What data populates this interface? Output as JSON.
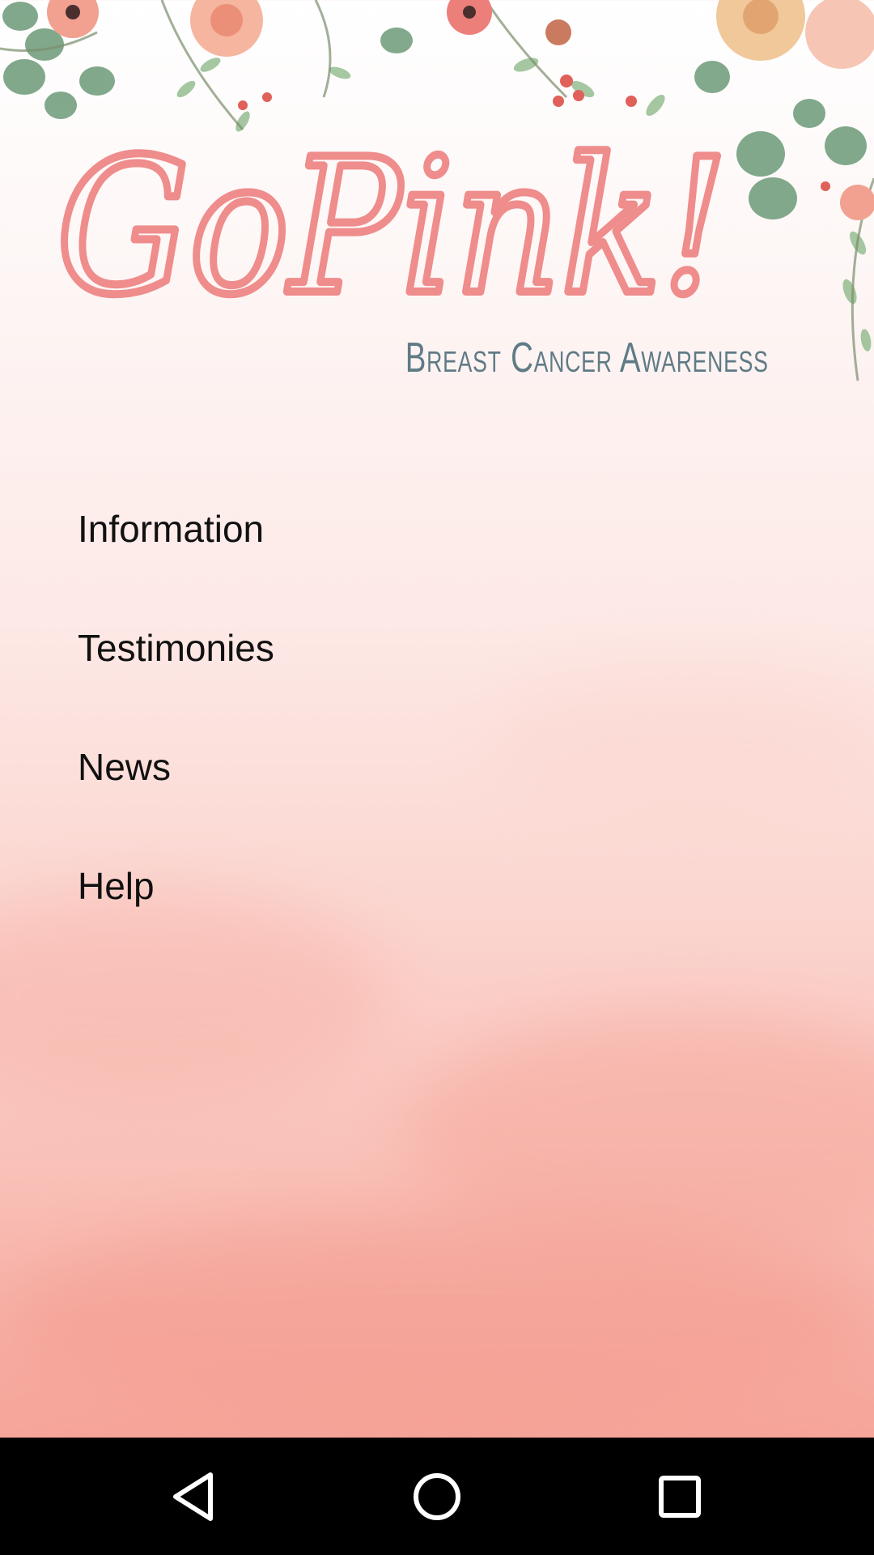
{
  "logo": {
    "title": "GoPink!",
    "subtitle": "Breast Cancer Awareness"
  },
  "menu": {
    "items": [
      {
        "label": "Information"
      },
      {
        "label": "Testimonies"
      },
      {
        "label": "News"
      },
      {
        "label": "Help"
      }
    ]
  },
  "navbar": {
    "back_icon": "back-triangle-icon",
    "home_icon": "home-circle-icon",
    "recents_icon": "recents-square-icon"
  },
  "colors": {
    "logo_pink": "#ef8c8c",
    "tagline": "#5f7b86",
    "background_bottom": "#f49a8e",
    "navbar": "#000000"
  }
}
